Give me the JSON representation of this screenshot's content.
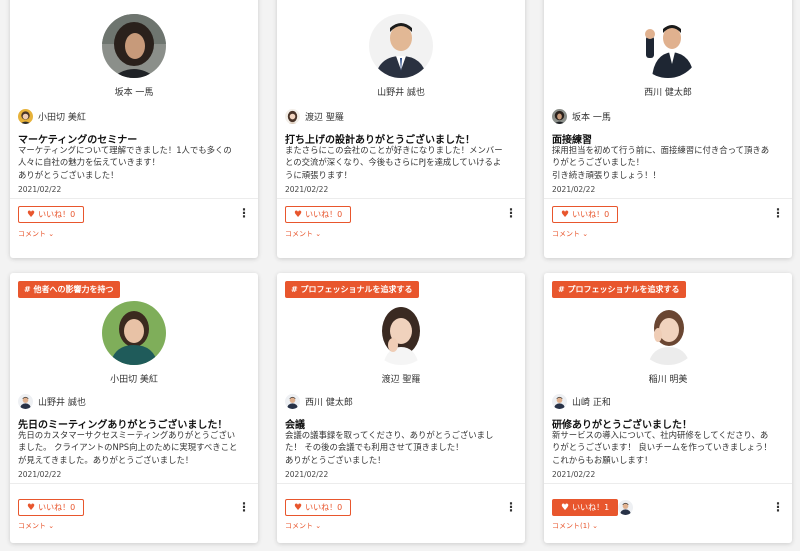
{
  "like_label": "いいね！",
  "comment_label": "コメント",
  "more_icon": "⋮",
  "accent_color": "#e8562d",
  "cards": [
    {
      "tag": "",
      "recipient": "坂本 一馬",
      "sender": "小田切 美紅",
      "title": "マーケティングのセミナー",
      "body": [
        "マーケティングについて理解できました！1人でも多くの",
        "人々に自社の魅力を伝えていきます！",
        "ありがとうございました！"
      ],
      "date": "2021/02/22",
      "like_count": "0",
      "liked": false,
      "comment_count": ""
    },
    {
      "tag": "",
      "recipient": "山野井 誠也",
      "sender": "渡辺 聖羅",
      "title": "打ち上げの設計ありがとうございました！",
      "body": [
        "またさらにこの会社のことが好きになりました！メンバー",
        "との交流が深くなり、今後もさらにPJを達成していけるよ",
        "うに頑張ります！"
      ],
      "date": "2021/02/22",
      "like_count": "0",
      "liked": false,
      "comment_count": ""
    },
    {
      "tag": "",
      "recipient": "西川 健太郎",
      "sender": "坂本 一馬",
      "title": "面接練習",
      "body": [
        "採用担当を初めて行う前に、面接練習に付き合って頂きあ",
        "りがとうございました！",
        "引き続き頑張りましょう！！"
      ],
      "date": "2021/02/22",
      "like_count": "0",
      "liked": false,
      "comment_count": ""
    },
    {
      "tag": "# 他者への影響力を持つ",
      "recipient": "小田切 美紅",
      "sender": "山野井 誠也",
      "title": "先日のミーティングありがとうございました！",
      "body": [
        "先日のカスタマーサクセスミーティングありがとうござい",
        "ました。 クライアントのNPS向上のために実現すべきこと",
        "が見えてきました。ありがとうございました！"
      ],
      "date": "2021/02/22",
      "like_count": "0",
      "liked": false,
      "comment_count": ""
    },
    {
      "tag": "# プロフェッショナルを追求する",
      "recipient": "渡辺 聖羅",
      "sender": "西川 健太郎",
      "title": "会議",
      "body": [
        "会議の議事録を取ってくださり、ありがとうございまし",
        "た！ その後の会議でも利用させて頂きました！",
        "ありがとうございました！"
      ],
      "date": "2021/02/22",
      "like_count": "0",
      "liked": false,
      "comment_count": ""
    },
    {
      "tag": "# プロフェッショナルを追求する",
      "recipient": "稲川 明美",
      "sender": "山崎 正和",
      "title": "研修ありがとうございました！",
      "body": [
        "新サービスの導入について、社内研修をしてくださり、あ",
        "りがとうございます！ 良いチームを作っていきましょう！",
        "これからもお願いします！"
      ],
      "date": "2021/02/22",
      "like_count": "1",
      "liked": true,
      "comment_count": "(1)"
    }
  ],
  "avatars": {
    "recipients": [
      "man-curly-hair",
      "man-suit-blue-bg",
      "man-suit-fist",
      "woman-green-shirt",
      "woman-hand-chin",
      "woman-hand-face"
    ],
    "senders": [
      "woman-yellow-bg",
      "woman-long-hair",
      "man-curly-hair",
      "man-suit",
      "man-suit-fist",
      "man-glasses"
    ]
  }
}
